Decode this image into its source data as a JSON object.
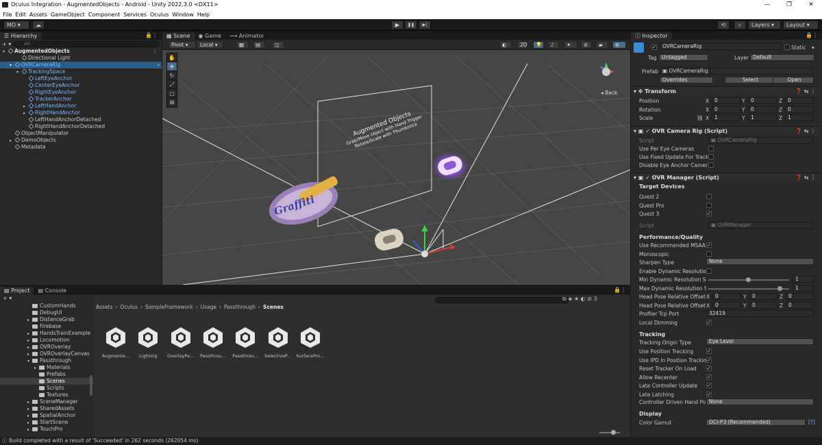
{
  "window": {
    "title": "Oculus Integration - AugmentedObjects - Android - Unity 2022.3.0 <DX11>",
    "controls": [
      "—",
      "❐",
      "✕"
    ]
  },
  "menu": [
    "File",
    "Edit",
    "Assets",
    "GameObject",
    "Component",
    "Services",
    "Oculus",
    "Window",
    "Help"
  ],
  "toolbar": {
    "account": "MO ▾",
    "layers": "Layers",
    "layout": "Layout",
    "play": "▶",
    "pause": "❚❚",
    "step": "▶|"
  },
  "hierarchy": {
    "tab": "Hierarchy",
    "search_placeholder": "All",
    "add": "+ ▾",
    "items": [
      {
        "label": "AugmentedObjects",
        "indent": 0,
        "blue": false,
        "bold": true,
        "sel": false,
        "arrow": "▾"
      },
      {
        "label": "Directional Light",
        "indent": 2,
        "blue": false,
        "bold": false,
        "sel": false,
        "arrow": ""
      },
      {
        "label": "OVRCameraRig",
        "indent": 1,
        "blue": true,
        "bold": false,
        "sel": true,
        "arrow": "▾"
      },
      {
        "label": "TrackingSpace",
        "indent": 2,
        "blue": true,
        "bold": false,
        "sel": false,
        "arrow": "▾"
      },
      {
        "label": "LeftEyeAnchor",
        "indent": 3,
        "blue": true,
        "bold": false,
        "sel": false,
        "arrow": ""
      },
      {
        "label": "CenterEyeAnchor",
        "indent": 3,
        "blue": true,
        "bold": false,
        "sel": false,
        "arrow": ""
      },
      {
        "label": "RightEyeAnchor",
        "indent": 3,
        "blue": true,
        "bold": false,
        "sel": false,
        "arrow": ""
      },
      {
        "label": "TrackerAnchor",
        "indent": 3,
        "blue": true,
        "bold": false,
        "sel": false,
        "arrow": ""
      },
      {
        "label": "LeftHandAnchor",
        "indent": 3,
        "blue": true,
        "bold": false,
        "sel": false,
        "arrow": "▸"
      },
      {
        "label": "RightHandAnchor",
        "indent": 3,
        "blue": true,
        "bold": false,
        "sel": false,
        "arrow": "▸"
      },
      {
        "label": "LeftHandAnchorDetached",
        "indent": 3,
        "blue": false,
        "bold": false,
        "sel": false,
        "arrow": ""
      },
      {
        "label": "RightHandAnchorDetached",
        "indent": 3,
        "blue": false,
        "bold": false,
        "sel": false,
        "arrow": ""
      },
      {
        "label": "ObjectManipulator",
        "indent": 1,
        "blue": false,
        "bold": false,
        "sel": false,
        "arrow": ""
      },
      {
        "label": "DemoObjects",
        "indent": 1,
        "blue": false,
        "bold": false,
        "sel": false,
        "arrow": "▸"
      },
      {
        "label": "Metadata",
        "indent": 1,
        "blue": false,
        "bold": false,
        "sel": false,
        "arrow": ""
      }
    ]
  },
  "scene": {
    "tabs": [
      "Scene",
      "Game",
      "Animator"
    ],
    "pivot": "Pivot ▾",
    "local": "Local ▾",
    "mode_2d": "2D",
    "back_label": "◂ Back",
    "canvas_title": "Augmented Objects",
    "canvas_line1": "Grab/Move object with Hand Trigger",
    "canvas_line2": "Rotate/Scale with Thumbstick",
    "graffiti": "Graffiti"
  },
  "project": {
    "tabs": [
      "Project",
      "Console"
    ],
    "breadcrumb": [
      "Assets",
      "Oculus",
      "SampleFramework",
      "Usage",
      "Passthrough",
      "Scenes"
    ],
    "folders": [
      {
        "label": "CustomHands",
        "indent": 0,
        "arrow": ""
      },
      {
        "label": "DebugUI",
        "indent": 0,
        "arrow": ""
      },
      {
        "label": "DistanceGrab",
        "indent": 0,
        "arrow": "▸"
      },
      {
        "label": "Firebase",
        "indent": 0,
        "arrow": ""
      },
      {
        "label": "HandsTrainExample",
        "indent": 0,
        "arrow": "▸"
      },
      {
        "label": "Locomotion",
        "indent": 0,
        "arrow": "▸"
      },
      {
        "label": "OVROverlay",
        "indent": 0,
        "arrow": "▸"
      },
      {
        "label": "OVROverlayCanvas",
        "indent": 0,
        "arrow": "▸"
      },
      {
        "label": "Passthrough",
        "indent": 0,
        "arrow": "▾"
      },
      {
        "label": "Materials",
        "indent": 1,
        "arrow": "▸"
      },
      {
        "label": "Prefabs",
        "indent": 1,
        "arrow": ""
      },
      {
        "label": "Scenes",
        "indent": 1,
        "arrow": "",
        "sel": true
      },
      {
        "label": "Scripts",
        "indent": 1,
        "arrow": ""
      },
      {
        "label": "Textures",
        "indent": 1,
        "arrow": ""
      },
      {
        "label": "SceneManager",
        "indent": 0,
        "arrow": "▸"
      },
      {
        "label": "SharedAssets",
        "indent": 0,
        "arrow": "▸"
      },
      {
        "label": "SpatialAnchor",
        "indent": 0,
        "arrow": "▸"
      },
      {
        "label": "StartScene",
        "indent": 0,
        "arrow": "▸"
      },
      {
        "label": "TouchPro",
        "indent": 0,
        "arrow": "▸"
      }
    ],
    "assets": [
      "Augmente...",
      "Lighting",
      "OverlayPa...",
      "Passthrou...",
      "Passthrou...",
      "SelectiveP...",
      "SurfacePro..."
    ],
    "counter": "3",
    "add": "+ ▾"
  },
  "status": {
    "message": "Build completed with a result of 'Succeeded' in 262 seconds (262054 ms)"
  },
  "inspector": {
    "tab": "Inspector",
    "object_name": "OVRCameraRig",
    "static_label": "Static",
    "tag_label": "Tag",
    "tag_value": "Untagged",
    "layer_label": "Layer",
    "layer_value": "Default",
    "prefab_label": "Prefab",
    "prefab_value": "OVRCameraRig",
    "overrides": "Overrides",
    "select": "Select",
    "open": "Open",
    "transform": {
      "title": "Transform",
      "position_label": "Position",
      "rotation_label": "Rotation",
      "scale_label": "Scale",
      "position": [
        "0",
        "0",
        "0"
      ],
      "rotation": [
        "0",
        "0",
        "0"
      ],
      "scale": [
        "1",
        "1",
        "1"
      ],
      "axes": [
        "X",
        "Y",
        "Z"
      ]
    },
    "camera_rig": {
      "title": "OVR Camera Rig (Script)",
      "script_label": "Script",
      "script_value": "OVRCameraRig",
      "rows": [
        "Use Per Eye Cameras",
        "Use Fixed Update For Track",
        "Disable Eye Anchor Cameras"
      ]
    },
    "manager": {
      "title": "OVR Manager (Script)",
      "target_devices": "Target Devices",
      "devices": [
        {
          "label": "Quest 2",
          "checked": false
        },
        {
          "label": "Quest Pro",
          "checked": false
        },
        {
          "label": "Quest 3",
          "checked": true
        }
      ],
      "script_label": "Script",
      "script_value": "OVRManager",
      "perf_header": "Performance/Quality",
      "msaa_label": "Use Recommended MSAA L",
      "monoscopic_label": "Monoscopic",
      "sharpen_label": "Sharpen Type",
      "sharpen_value": "None",
      "dyn_res_label": "Enable Dynamic Resolution",
      "min_dyn_label": "Min Dynamic Resolution Sc",
      "min_dyn_value": "1",
      "max_dyn_label": "Max Dynamic Resolution Sc",
      "max_dyn_value": "1",
      "pos_offset_label": "Head Pose Relative Offset P",
      "rot_offset_label": "Head Pose Relative Offset R",
      "offset_values": [
        "0",
        "0",
        "0"
      ],
      "profiler_label": "Profiler Tcp Port",
      "profiler_value": "32419",
      "dimming_label": "Local Dimming",
      "tracking_header": "Tracking",
      "origin_label": "Tracking Origin Type",
      "origin_value": "Eye Level",
      "tracking_rows": [
        {
          "label": "Use Position Tracking",
          "checked": true
        },
        {
          "label": "Use IPD In Position Tracking",
          "checked": true
        },
        {
          "label": "Reset Tracker On Load",
          "checked": true
        },
        {
          "label": "Allow Recenter",
          "checked": true
        },
        {
          "label": "Late Controller Update",
          "checked": true
        },
        {
          "label": "Late Latching",
          "checked": true
        }
      ],
      "hand_pose_label": "Controller Driven Hand Pose",
      "hand_pose_value": "None",
      "display_header": "Display",
      "gamut_label": "Color Gamut",
      "gamut_value": "DCI-P3 (Recommended)"
    }
  },
  "colors": {
    "accent": "#2c5d87",
    "blue_text": "#7fb7ff",
    "scene_bg": "#454545"
  }
}
